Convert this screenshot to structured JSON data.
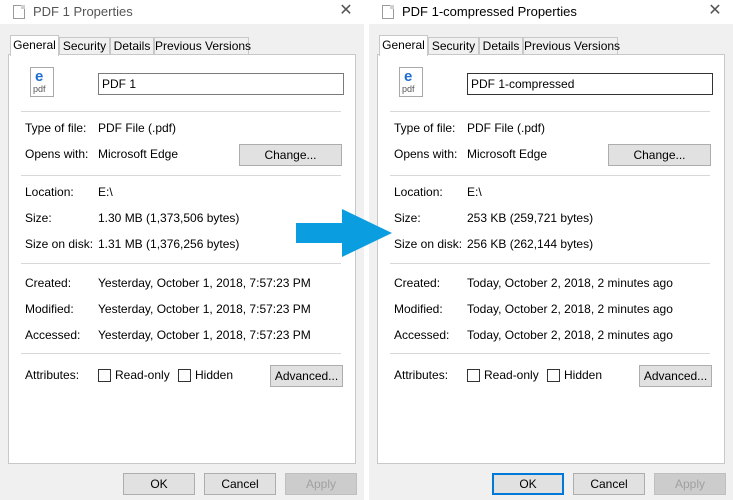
{
  "left": {
    "title": "PDF 1 Properties",
    "tabs": [
      "General",
      "Security",
      "Details",
      "Previous Versions"
    ],
    "filename": "PDF 1",
    "type_label": "Type of file:",
    "type_value": "PDF File (.pdf)",
    "opens_label": "Opens with:",
    "opens_value": "Microsoft Edge",
    "change_button": "Change...",
    "location_label": "Location:",
    "location_value": "E:\\",
    "size_label": "Size:",
    "size_value": "1.30 MB (1,373,506 bytes)",
    "disk_label": "Size on disk:",
    "disk_value": "1.31 MB (1,376,256 bytes)",
    "created_label": "Created:",
    "created_value": "Yesterday, October 1, 2018, 7:57:23 PM",
    "modified_label": "Modified:",
    "modified_value": "Yesterday, October 1, 2018, 7:57:23 PM",
    "accessed_label": "Accessed:",
    "accessed_value": "Yesterday, October 1, 2018, 7:57:23 PM",
    "attributes_label": "Attributes:",
    "readonly_label": "Read-only",
    "readonly_checked": false,
    "hidden_label": "Hidden",
    "hidden_checked": false,
    "advanced_button": "Advanced...",
    "ok_button": "OK",
    "cancel_button": "Cancel",
    "apply_button": "Apply",
    "icon_letter": "e",
    "icon_caption": "pdf"
  },
  "right": {
    "title": "PDF 1-compressed Properties",
    "tabs": [
      "General",
      "Security",
      "Details",
      "Previous Versions"
    ],
    "filename": "PDF 1-compressed",
    "type_label": "Type of file:",
    "type_value": "PDF File (.pdf)",
    "opens_label": "Opens with:",
    "opens_value": "Microsoft Edge",
    "change_button": "Change...",
    "location_label": "Location:",
    "location_value": "E:\\",
    "size_label": "Size:",
    "size_value": "253 KB (259,721 bytes)",
    "disk_label": "Size on disk:",
    "disk_value": "256 KB (262,144 bytes)",
    "created_label": "Created:",
    "created_value": "Today, October 2, 2018, 2 minutes ago",
    "modified_label": "Modified:",
    "modified_value": "Today, October 2, 2018, 2 minutes ago",
    "accessed_label": "Accessed:",
    "accessed_value": "Today, October 2, 2018, 2 minutes ago",
    "attributes_label": "Attributes:",
    "readonly_label": "Read-only",
    "readonly_checked": false,
    "hidden_label": "Hidden",
    "hidden_checked": false,
    "advanced_button": "Advanced...",
    "ok_button": "OK",
    "cancel_button": "Cancel",
    "apply_button": "Apply",
    "icon_letter": "e",
    "icon_caption": "pdf"
  },
  "close_glyph": "✕",
  "arrow_icon": "right-arrow-icon",
  "colors": {
    "arrow": "#0a9ddf",
    "edge_icon": "#1f6fd0",
    "primary_border": "#0078d7"
  }
}
